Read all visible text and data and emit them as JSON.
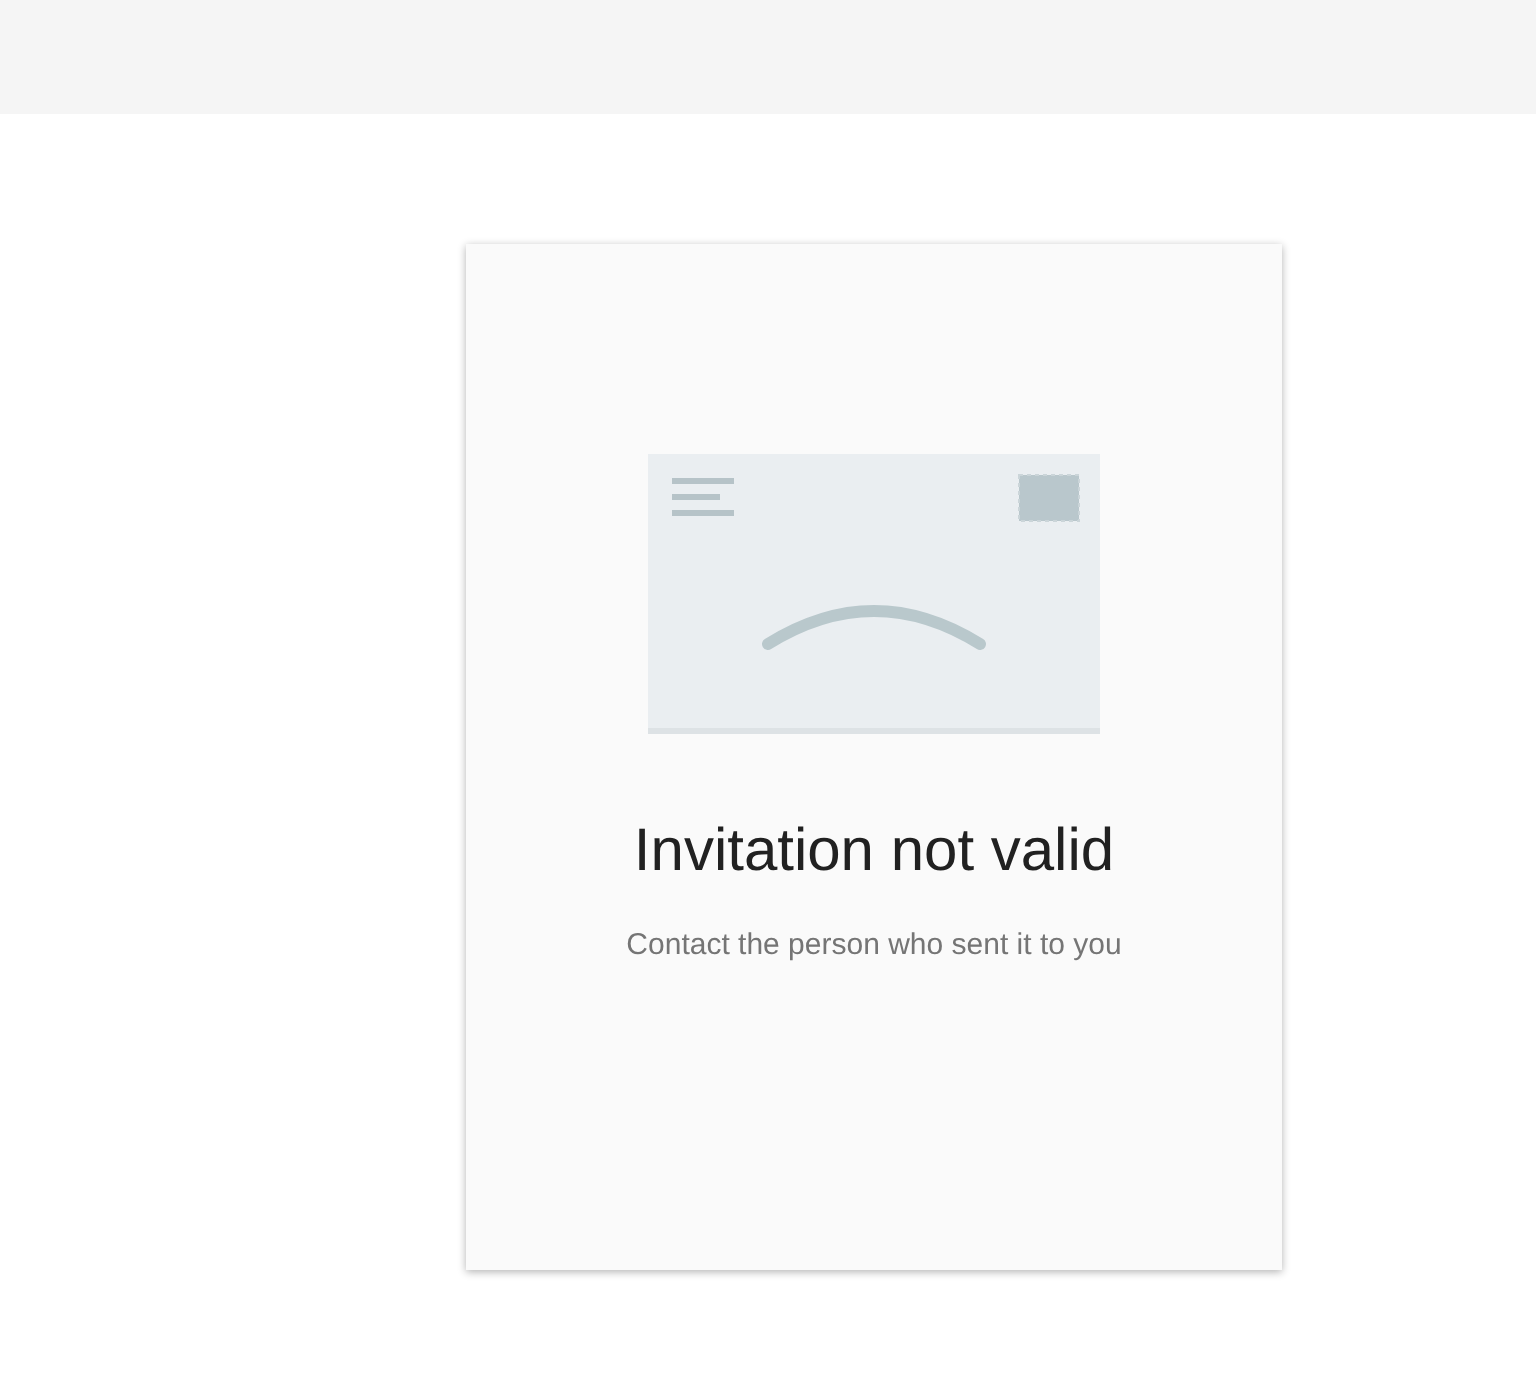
{
  "card": {
    "title": "Invitation not valid",
    "message": "Contact the person who sent it to you"
  }
}
